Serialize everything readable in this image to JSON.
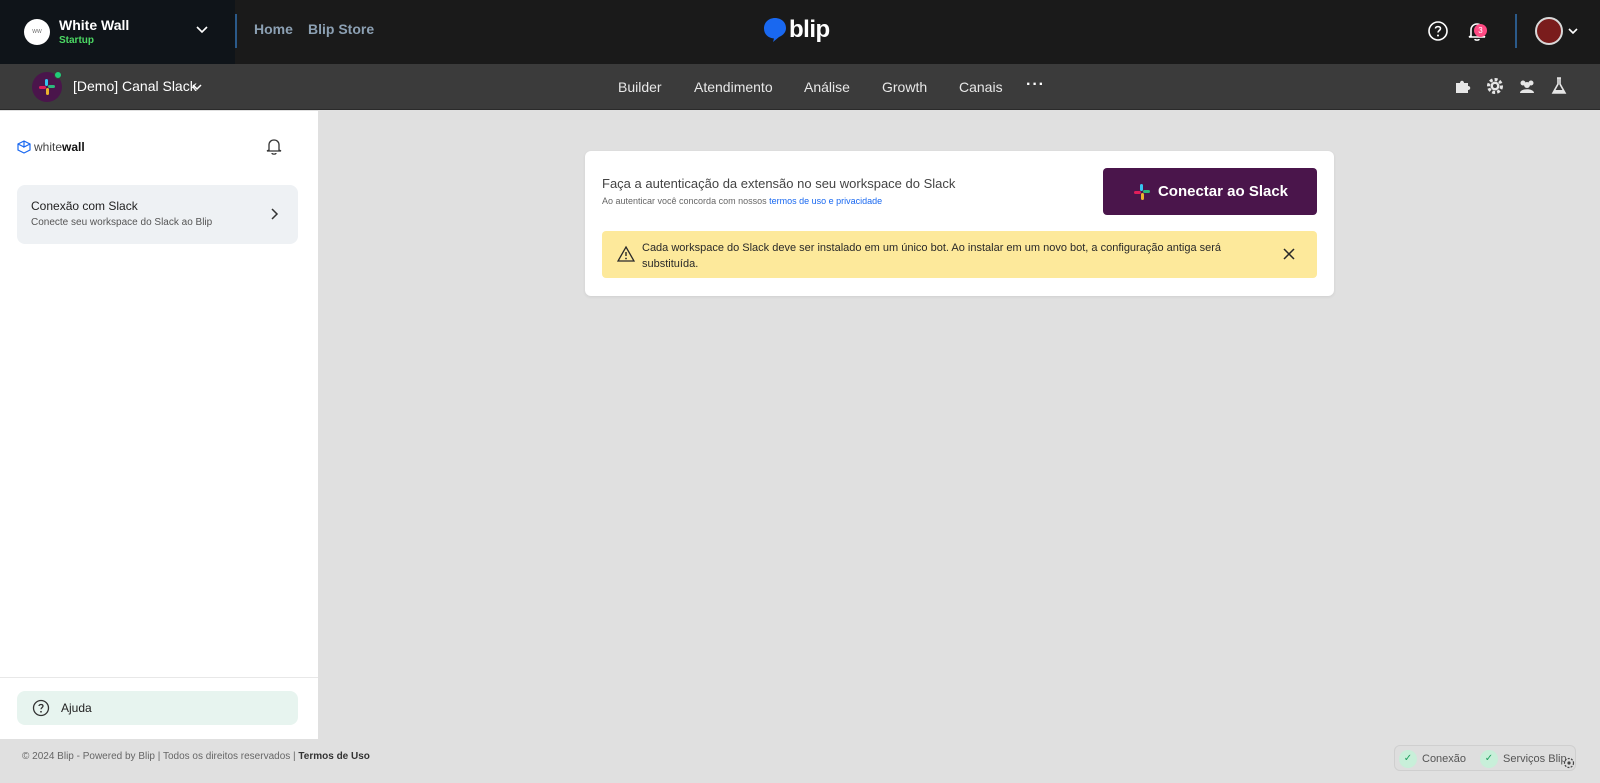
{
  "org": {
    "avatar_text": "WW",
    "name": "White Wall",
    "plan": "Startup"
  },
  "topnav": {
    "home": "Home",
    "store": "Blip Store"
  },
  "brand": {
    "logo": "blip",
    "accent": "#1968f0"
  },
  "notifications": {
    "count": "3"
  },
  "bot": {
    "name": "[Demo] Canal Slack"
  },
  "tabs": [
    "Builder",
    "Atendimento",
    "Análise",
    "Growth",
    "Canais"
  ],
  "more": "···",
  "sidebar": {
    "logo_light": "white",
    "logo_bold": "wall",
    "item_title": "Conexão com Slack",
    "item_subtitle": "Conecte seu workspace do Slack ao Blip",
    "help": "Ajuda"
  },
  "card": {
    "title": "Faça a autenticação da extensão no seu workspace do Slack",
    "subtitle_prefix": "Ao autenticar você concorda com nossos ",
    "subtitle_link": "termos de uso e privacidade",
    "button": "Conectar ao Slack",
    "alert": "Cada workspace do Slack deve ser instalado em um único bot. Ao instalar em um novo bot, a configuração antiga será substituída."
  },
  "footer": {
    "text": "© 2024 Blip - Powered by Blip | Todos os direitos reservados | ",
    "terms": "Termos de Uso"
  },
  "status": {
    "connection": "Conexão",
    "services": "Serviços Blip",
    "ok_glyph": "✓"
  },
  "colors": {
    "slack_purple": "#4a154b",
    "alert_yellow": "#fde99b",
    "online_green": "#21cc79",
    "badge_pink": "#ff4a83"
  }
}
